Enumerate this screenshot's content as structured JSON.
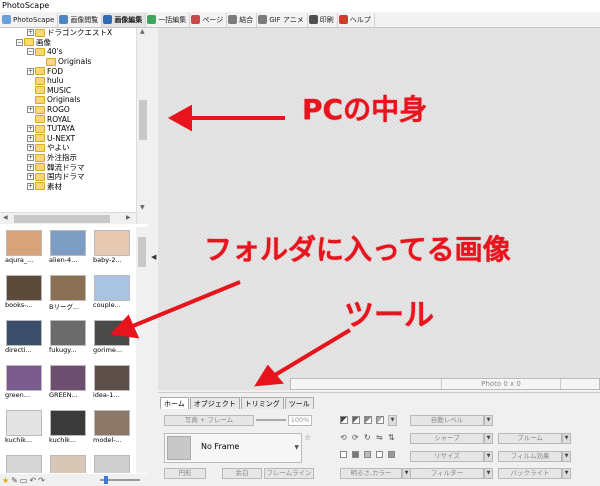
{
  "window": {
    "title": "PhotoScape"
  },
  "tabs": [
    {
      "label": "PhotoScape",
      "icon": "photoscape-icon",
      "color": "#6aa0d8"
    },
    {
      "label": "画像閲覧",
      "icon": "viewer-icon",
      "color": "#4e86c4"
    },
    {
      "label": "画像編集",
      "icon": "editor-icon",
      "color": "#2f6db5",
      "active": true
    },
    {
      "label": "一括編集",
      "icon": "batch-icon",
      "color": "#3fa55a"
    },
    {
      "label": "ページ",
      "icon": "page-icon",
      "color": "#c94a4a"
    },
    {
      "label": "結合",
      "icon": "combine-icon",
      "color": "#7c7c7c"
    },
    {
      "label": "GIF アニメ",
      "icon": "gif-icon",
      "color": "#7b7b7b"
    },
    {
      "label": "印刷",
      "icon": "print-icon",
      "color": "#505050"
    },
    {
      "label": "ヘルプ",
      "icon": "help-icon",
      "color": "#d23a2a"
    }
  ],
  "tree": [
    {
      "label": "ドラゴンクエストX",
      "indent": 3,
      "expander": "+"
    },
    {
      "label": "画像",
      "indent": 2,
      "expander": "−"
    },
    {
      "label": "40's",
      "indent": 3,
      "expander": "−"
    },
    {
      "label": "Originals",
      "indent": 4,
      "expander": ""
    },
    {
      "label": "FOD",
      "indent": 3,
      "expander": "+"
    },
    {
      "label": "hulu",
      "indent": 3,
      "expander": ""
    },
    {
      "label": "MUSIC",
      "indent": 3,
      "expander": ""
    },
    {
      "label": "Originals",
      "indent": 3,
      "expander": ""
    },
    {
      "label": "ROGO",
      "indent": 3,
      "expander": "+"
    },
    {
      "label": "ROYAL",
      "indent": 3,
      "expander": ""
    },
    {
      "label": "TUTAYA",
      "indent": 3,
      "expander": "+"
    },
    {
      "label": "U-NEXT",
      "indent": 3,
      "expander": "+"
    },
    {
      "label": "やよい",
      "indent": 3,
      "expander": "+"
    },
    {
      "label": "外注指示",
      "indent": 3,
      "expander": "+"
    },
    {
      "label": "韓流ドラマ",
      "indent": 3,
      "expander": "+"
    },
    {
      "label": "国内ドラマ",
      "indent": 3,
      "expander": "+"
    },
    {
      "label": "素材",
      "indent": 3,
      "expander": "+"
    }
  ],
  "thumbnails": [
    {
      "caption": "aqura_...",
      "color": "#d9a37a"
    },
    {
      "caption": "alien-4...",
      "color": "#7d9ec2"
    },
    {
      "caption": "baby-2...",
      "color": "#e6c9b0"
    },
    {
      "caption": "books-...",
      "color": "#5c4a3a"
    },
    {
      "caption": "Bリーグ...",
      "color": "#8a6f55"
    },
    {
      "caption": "couple...",
      "color": "#a9c4e0"
    },
    {
      "caption": "directi...",
      "color": "#3a4d6b"
    },
    {
      "caption": "fukugy...",
      "color": "#6b6b6b"
    },
    {
      "caption": "gorime...",
      "color": "#4a4a4a"
    },
    {
      "caption": "green...",
      "color": "#7a5b8e"
    },
    {
      "caption": "GREEN...",
      "color": "#6c4f6f"
    },
    {
      "caption": "idea-1...",
      "color": "#5e5048"
    },
    {
      "caption": "kuchik...",
      "color": "#e4e4e4"
    },
    {
      "caption": "kuchik...",
      "color": "#3a3a3a"
    },
    {
      "caption": "model-...",
      "color": "#8c7868"
    },
    {
      "caption": "",
      "color": "#d6d6d6"
    },
    {
      "caption": "",
      "color": "#d8c6b6"
    },
    {
      "caption": "",
      "color": "#cfcfcf"
    }
  ],
  "canvas": {
    "status": "Photo 0 x 0"
  },
  "toolTabs": [
    "ホーム",
    "オブジェクト",
    "トリミング",
    "ツール"
  ],
  "tools": {
    "photo_frame": "写真 + フレーム",
    "zoom_pct": "100%",
    "frame_name": "No Frame",
    "circle": "円形",
    "margin": "余白",
    "frame_line": "フレームライン",
    "auto_level": "自動レベル",
    "sharpen": "シャープ",
    "bloom": "ブルーム",
    "resize": "リサイズ",
    "film_effect": "フィルム効果",
    "backlight": "バックライト",
    "brightness_color": "明るさ,カラー",
    "filter": "フィルター"
  },
  "annotations": {
    "pc_contents": "PCの中身",
    "folder_images": "フォルダに入ってる画像",
    "tools": "ツール"
  },
  "colors": {
    "annotation_red": "#e8141d",
    "folder_yellow": "#f8d775"
  }
}
